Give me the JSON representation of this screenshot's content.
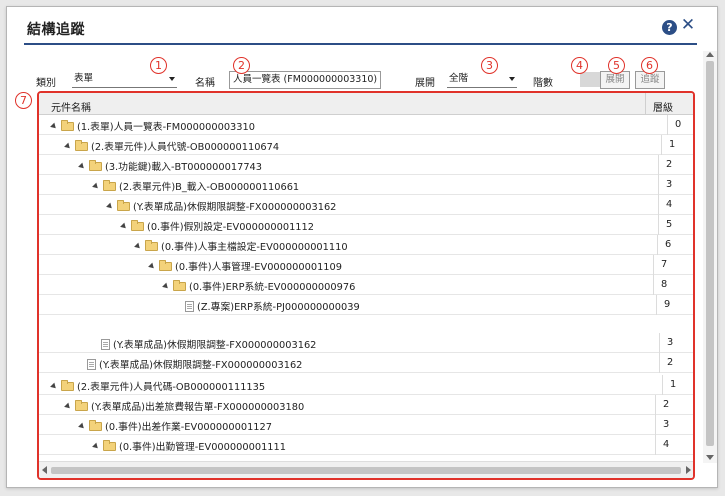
{
  "dialog": {
    "title": "結構追蹤",
    "help_glyph": "?",
    "close_glyph": "✕",
    "accent_color": "#2c4e86",
    "annotation_color": "#e0322a"
  },
  "toolbar": {
    "category_label": "類別",
    "category_value": "表單",
    "name_label": "名稱",
    "name_value": "人員一覽表 (FM000000003310)",
    "expand_label": "展開",
    "expand_value": "全階",
    "level_label": "階數",
    "expand_button": "展開",
    "trace_button": "追蹤"
  },
  "badges": [
    "1",
    "2",
    "3",
    "4",
    "5",
    "6",
    "7"
  ],
  "tree": {
    "columns": {
      "name": "元件名稱",
      "level": "層級"
    },
    "rows": [
      {
        "label": "(1.表單)人員一覽表-FM000000003310",
        "level": "0",
        "icon": "folder-icon",
        "expanded": true
      },
      {
        "label": "(2.表單元件)人員代號-OB000000110674",
        "level": "1",
        "icon": "folder-icon",
        "expanded": true
      },
      {
        "label": "(3.功能鍵)載入-BT000000017743",
        "level": "2",
        "icon": "folder-icon",
        "expanded": true
      },
      {
        "label": "(2.表單元件)B_載入-OB000000110661",
        "level": "3",
        "icon": "folder-icon",
        "expanded": true
      },
      {
        "label": "(Y.表單成品)休假期限調整-FX000000003162",
        "level": "4",
        "icon": "folder-icon",
        "expanded": true
      },
      {
        "label": "(0.事件)假別設定-EV000000001112",
        "level": "5",
        "icon": "folder-icon",
        "expanded": true
      },
      {
        "label": "(0.事件)人事主檔設定-EV000000001110",
        "level": "6",
        "icon": "folder-icon",
        "expanded": true
      },
      {
        "label": "(0.事件)人事管理-EV000000001109",
        "level": "7",
        "icon": "folder-icon",
        "expanded": true
      },
      {
        "label": "(0.事件)ERP系統-EV000000000976",
        "level": "8",
        "icon": "folder-icon",
        "expanded": true
      },
      {
        "label": "(Z.專案)ERP系統-PJ000000000039",
        "level": "9",
        "icon": "document-icon",
        "expanded": false
      },
      {
        "label": "(Y.表單成品)休假期限調整-FX000000003162",
        "level": "3",
        "icon": "document-icon",
        "expanded": false
      },
      {
        "label": "(Y.表單成品)休假期限調整-FX000000003162",
        "level": "2",
        "icon": "document-icon",
        "expanded": false
      },
      {
        "label": "(2.表單元件)人員代碼-OB000000111135",
        "level": "1",
        "icon": "folder-icon",
        "expanded": true
      },
      {
        "label": "(Y.表單成品)出差旅費報告單-FX000000003180",
        "level": "2",
        "icon": "folder-icon",
        "expanded": true
      },
      {
        "label": "(0.事件)出差作業-EV000000001127",
        "level": "3",
        "icon": "folder-icon",
        "expanded": true
      },
      {
        "label": "(0.事件)出勤管理-EV000000001111",
        "level": "4",
        "icon": "folder-icon",
        "expanded": true
      }
    ]
  }
}
